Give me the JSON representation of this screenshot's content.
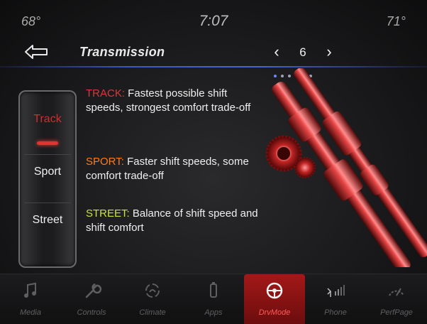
{
  "status": {
    "temp_left": "68°",
    "time": "7:07",
    "temp_right": "71°"
  },
  "header": {
    "title": "Transmission",
    "page": "6",
    "page_count": 6,
    "page_index": 1
  },
  "modes": [
    {
      "label": "Track",
      "selected": true
    },
    {
      "label": "Sport",
      "selected": false
    },
    {
      "label": "Street",
      "selected": false
    }
  ],
  "descriptions": [
    {
      "key": "TRACK:",
      "text": " Fastest possible shift speeds, strongest comfort trade-off",
      "color": "#d63a3a"
    },
    {
      "key": "SPORT:",
      "text": " Faster shift speeds, some comfort trade-off",
      "color": "#ff7a1c"
    },
    {
      "key": "STREET:",
      "text": " Balance of shift speed and shift comfort",
      "color": "#c8e33a"
    }
  ],
  "nav": [
    {
      "label": "Media",
      "icon": "music-note-icon"
    },
    {
      "label": "Controls",
      "icon": "wrench-icon"
    },
    {
      "label": "Climate",
      "icon": "climate-icon"
    },
    {
      "label": "Apps",
      "icon": "apps-icon"
    },
    {
      "label": "DrvMode",
      "icon": "steering-wheel-icon",
      "active": true
    },
    {
      "label": "Phone",
      "icon": "phone-signal-icon"
    },
    {
      "label": "PerfPage",
      "icon": "gauge-icon"
    }
  ],
  "colors": {
    "accent_red": "#c21a1a",
    "divider_blue": "#4a63d8"
  }
}
